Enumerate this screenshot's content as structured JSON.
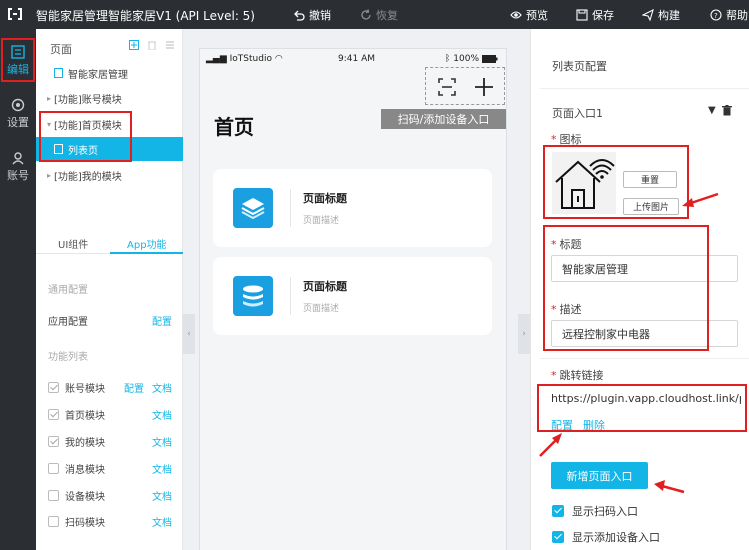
{
  "topbar": {
    "title": "智能家居管理智能家居V1 (API Level: 5)",
    "undo": "撤销",
    "redo": "恢复",
    "preview": "预览",
    "save": "保存",
    "build": "构建",
    "help": "帮助"
  },
  "rail": {
    "items": [
      {
        "label": "编辑",
        "icon": "edit-icon"
      },
      {
        "label": "设置",
        "icon": "settings-icon"
      },
      {
        "label": "账号",
        "icon": "account-icon"
      }
    ]
  },
  "tree": {
    "header": "页面",
    "items": [
      {
        "label": "智能家居管理"
      },
      {
        "label": "[功能]账号模块"
      },
      {
        "label": "[功能]首页模块"
      },
      {
        "label": "列表页"
      },
      {
        "label": "[功能]我的模块"
      }
    ]
  },
  "tabs": {
    "ui": "UI组件",
    "app": "App功能"
  },
  "config": {
    "general_label": "通用配置",
    "app_config": "应用配置",
    "config_link": "配置",
    "feature_list_label": "功能列表",
    "doc_link": "文档",
    "features": [
      {
        "name": "账号模块",
        "checked": true,
        "has_config": true
      },
      {
        "name": "首页模块",
        "checked": true,
        "has_config": false
      },
      {
        "name": "我的模块",
        "checked": true,
        "has_config": false
      },
      {
        "name": "消息模块",
        "checked": false,
        "has_config": false
      },
      {
        "name": "设备模块",
        "checked": false,
        "has_config": false
      },
      {
        "name": "扫码模块",
        "checked": false,
        "has_config": false
      }
    ]
  },
  "phone": {
    "carrier": "IoTStudio",
    "time": "9:41 AM",
    "battery": "100%",
    "tooltip": "扫码/添加设备入口",
    "page_title": "首页",
    "cards": [
      {
        "title": "页面标题",
        "desc": "页面描述"
      },
      {
        "title": "页面标题",
        "desc": "页面描述"
      }
    ]
  },
  "right": {
    "title": "列表页配置",
    "entry_title": "页面入口1",
    "icon_label": "图标",
    "reset_btn": "重置",
    "upload_btn": "上传图片",
    "title_label": "标题",
    "title_value": "智能家居管理",
    "desc_label": "描述",
    "desc_value": "远程控制家中电器",
    "link_label": "跳转链接",
    "link_value": "https://plugin.vapp.cloudhost.link/plugin",
    "link_config": "配置",
    "link_delete": "删除",
    "add_entry_btn": "新增页面入口",
    "show_scan": "显示扫码入口",
    "show_add_device": "显示添加设备入口"
  },
  "colors": {
    "accent": "#13b5e6",
    "annotation": "#e02020",
    "dark": "#2b2e33"
  }
}
